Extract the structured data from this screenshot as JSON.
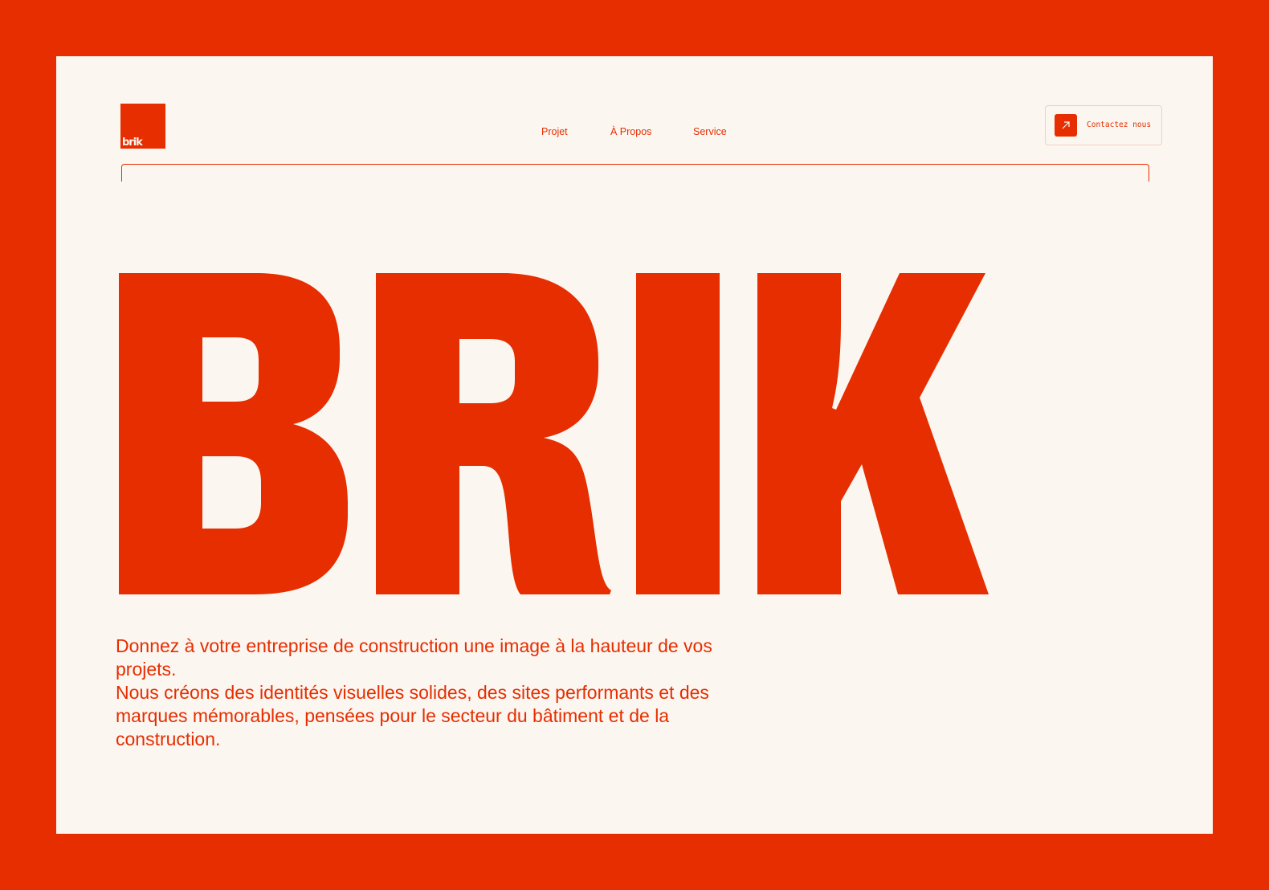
{
  "brand": {
    "logo_text": "brik",
    "hero_title": "BRIK"
  },
  "nav": {
    "items": [
      {
        "label": "Projet"
      },
      {
        "label": "À Propos"
      },
      {
        "label": "Service"
      }
    ]
  },
  "header": {
    "contact_label": "Contactez nous",
    "contact_icon": "arrow-up-right-icon"
  },
  "hero": {
    "lines": [
      "Donnez à votre entreprise de construction une image à la hauteur de vos projets.",
      "Nous créons des identités visuelles solides, des sites performants et des marques mémorables, pensées pour le secteur du bâtiment et de la construction."
    ]
  },
  "colors": {
    "accent": "#E62E00",
    "background": "#FCF6F1"
  }
}
